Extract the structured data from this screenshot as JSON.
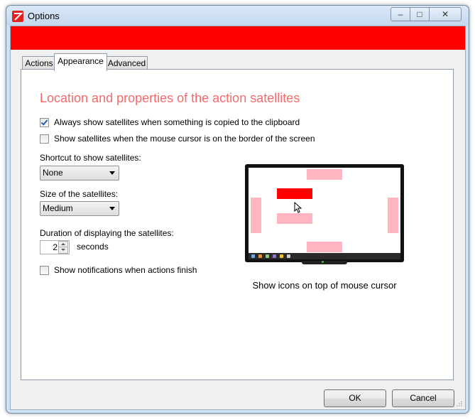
{
  "window": {
    "title": "Options",
    "controls": {
      "minimize": "–",
      "maximize": "□",
      "close": "✕"
    }
  },
  "banner": {
    "color": "#fe0000"
  },
  "tabs": [
    {
      "label": "Actions",
      "selected": false
    },
    {
      "label": "Appearance",
      "selected": true
    },
    {
      "label": "Advanced",
      "selected": false
    }
  ],
  "appearance": {
    "heading": "Location and properties of the action satellites",
    "always_show": {
      "label": "Always show satellites when something is copied to the clipboard",
      "checked": true
    },
    "border_show": {
      "label": "Show satellites when the mouse cursor is on the border of the screen",
      "checked": false
    },
    "shortcut": {
      "label": "Shortcut to show satellites:",
      "value": "None"
    },
    "size": {
      "label": "Size of the satellites:",
      "value": "Medium"
    },
    "duration": {
      "label": "Duration of displaying the satellites:",
      "value": "2",
      "unit": "seconds"
    },
    "notifications": {
      "label": "Show notifications when actions finish",
      "checked": false
    },
    "preview_caption": "Show icons on top of mouse cursor"
  },
  "buttons": {
    "ok": "OK",
    "cancel": "Cancel"
  },
  "colors": {
    "heading": "#f26b6b",
    "satellite": "#ffb6c1",
    "satellite_active": "#ff0000"
  }
}
